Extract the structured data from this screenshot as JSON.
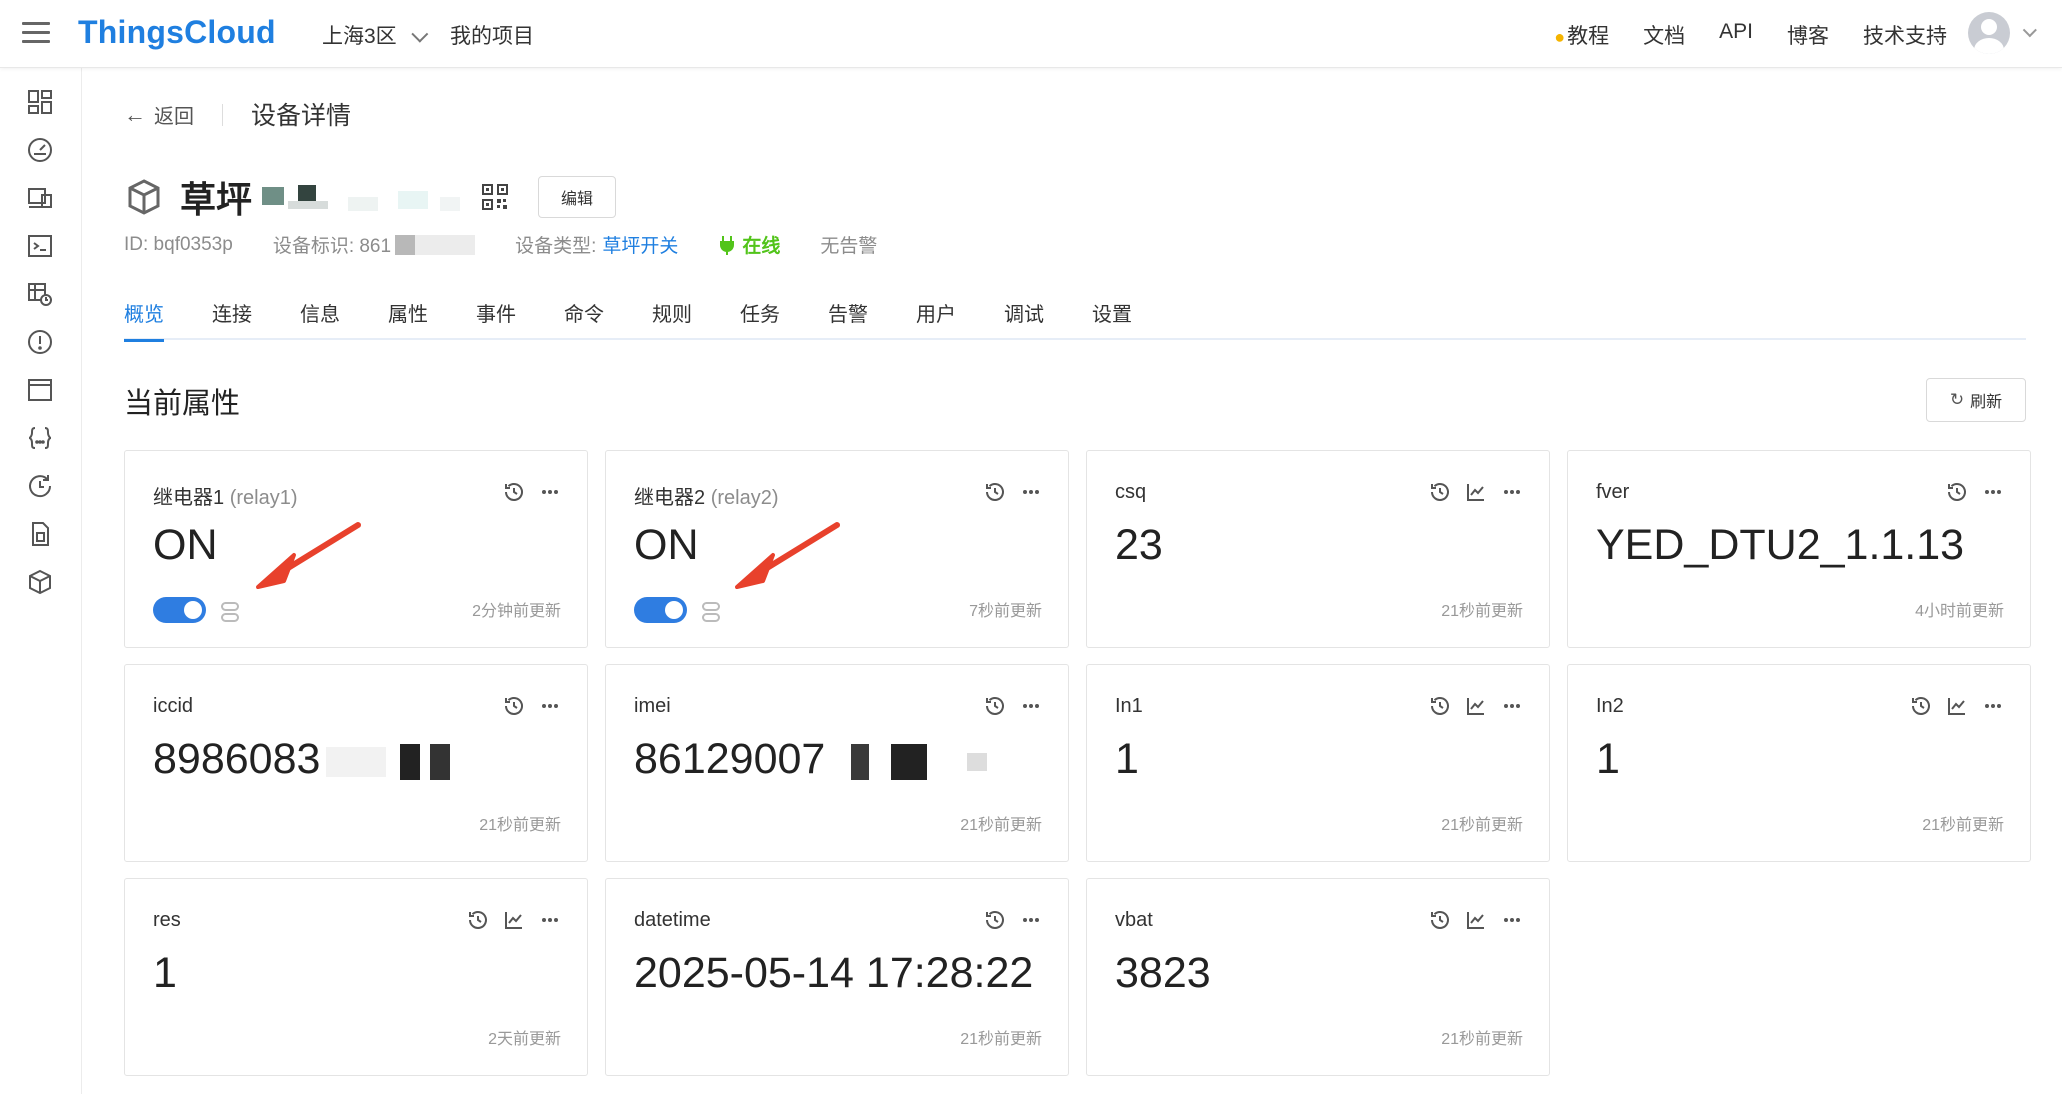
{
  "header": {
    "logo": "ThingsCloud",
    "region": "上海3区",
    "my_projects": "我的项目",
    "nav": [
      "教程",
      "文档",
      "API",
      "博客",
      "技术支持"
    ]
  },
  "page": {
    "back": "返回",
    "title": "设备详情"
  },
  "device": {
    "name": "草坪",
    "edit": "编辑",
    "id_label": "ID: bqf0353p",
    "ident_label": "设备标识: 861",
    "type_label": "设备类型:",
    "type_value": "草坪开关",
    "status": "在线",
    "alarm": "无告警"
  },
  "tabs": [
    "概览",
    "连接",
    "信息",
    "属性",
    "事件",
    "命令",
    "规则",
    "任务",
    "告警",
    "用户",
    "调试",
    "设置"
  ],
  "section": {
    "title": "当前属性",
    "refresh": "刷新"
  },
  "properties": [
    {
      "name": "继电器1",
      "id": "(relay1)",
      "value": "ON",
      "updated": "2分钟前更新",
      "switch": true,
      "chart": false
    },
    {
      "name": "继电器2",
      "id": "(relay2)",
      "value": "ON",
      "updated": "7秒前更新",
      "switch": true,
      "chart": false
    },
    {
      "name": "csq",
      "id": "",
      "value": "23",
      "updated": "21秒前更新",
      "switch": false,
      "chart": true
    },
    {
      "name": "fver",
      "id": "",
      "value": "YED_DTU2_1.1.13",
      "updated": "4小时前更新",
      "switch": false,
      "chart": false
    },
    {
      "name": "iccid",
      "id": "",
      "value": "8986083",
      "updated": "21秒前更新",
      "switch": false,
      "chart": false
    },
    {
      "name": "imei",
      "id": "",
      "value": "86129007",
      "updated": "21秒前更新",
      "switch": false,
      "chart": false
    },
    {
      "name": "In1",
      "id": "",
      "value": "1",
      "updated": "21秒前更新",
      "switch": false,
      "chart": true
    },
    {
      "name": "In2",
      "id": "",
      "value": "1",
      "updated": "21秒前更新",
      "switch": false,
      "chart": true
    },
    {
      "name": "res",
      "id": "",
      "value": "1",
      "updated": "2天前更新",
      "switch": false,
      "chart": true
    },
    {
      "name": "datetime",
      "id": "",
      "value": "2025-05-14 17:28:22",
      "updated": "21秒前更新",
      "switch": false,
      "chart": false
    },
    {
      "name": "vbat",
      "id": "",
      "value": "3823",
      "updated": "21秒前更新",
      "switch": false,
      "chart": true
    }
  ],
  "colors": {
    "brand": "#1f7fe0",
    "online": "#52c41a",
    "annotation_arrow": "#e8412c"
  }
}
